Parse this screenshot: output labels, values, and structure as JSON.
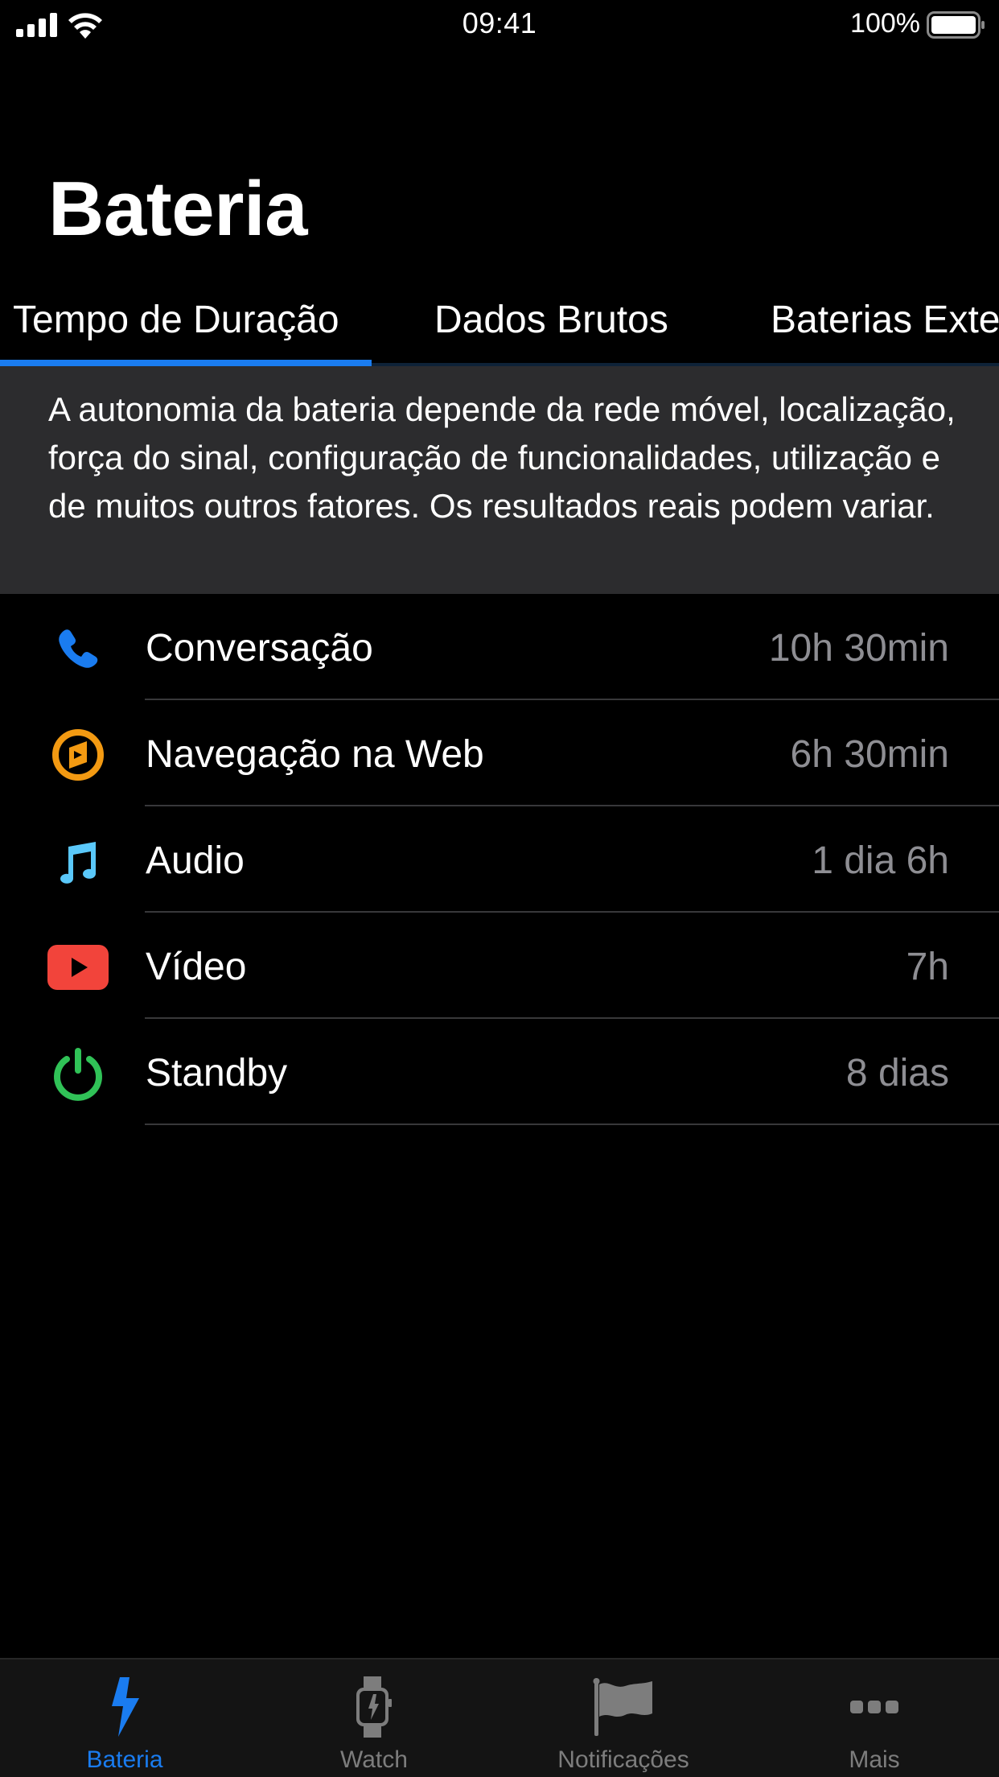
{
  "status_bar": {
    "time": "09:41",
    "battery_percent_label": "100%",
    "battery_level": 1.0,
    "signal_bars": 4,
    "icons": [
      "cellular-signal-icon",
      "wifi-icon",
      "battery-icon"
    ]
  },
  "header": {
    "title": "Bateria"
  },
  "tabs": [
    {
      "label": "Tempo de Duração",
      "active": true
    },
    {
      "label": "Dados Brutos",
      "active": false
    },
    {
      "label": "Baterias Exte",
      "active": false
    }
  ],
  "info": {
    "text": "A autonomia da bateria depende da rede móvel, localização, força do sinal, configuração de funcionalidades, utilização e de muitos outros fatores. Os resultados reais podem variar."
  },
  "usage_list": [
    {
      "icon": "phone-icon",
      "label": "Conversação",
      "value": "10h 30min",
      "color": "#1a7cf0"
    },
    {
      "icon": "compass-icon",
      "label": "Navegação na Web",
      "value": "6h 30min",
      "color": "#f39a12"
    },
    {
      "icon": "music-note-icon",
      "label": "Audio",
      "value": "1 dia 6h",
      "color": "#5ac8fa"
    },
    {
      "icon": "video-play-icon",
      "label": "Vídeo",
      "value": "7h",
      "color": "#f2443b"
    },
    {
      "icon": "power-icon",
      "label": "Standby",
      "value": "8 dias",
      "color": "#30c257"
    }
  ],
  "tab_bar": {
    "items": [
      {
        "label": "Bateria",
        "icon": "lightning-bolt-icon",
        "active": true
      },
      {
        "label": "Watch",
        "icon": "watch-icon",
        "active": false
      },
      {
        "label": "Notificações",
        "icon": "flag-icon",
        "active": false
      },
      {
        "label": "Mais",
        "icon": "more-dots-icon",
        "active": false
      }
    ]
  },
  "colors": {
    "accent": "#1a7cf0",
    "background": "#000000",
    "info_background": "#2c2c2e",
    "secondary_text": "#8e8e93",
    "inactive_tab": "#7d7d7d"
  }
}
